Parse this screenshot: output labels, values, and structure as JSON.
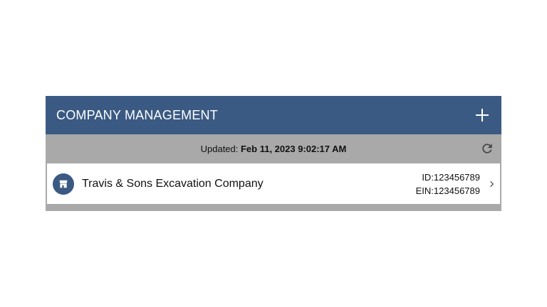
{
  "header": {
    "title": "COMPANY MANAGEMENT",
    "add_icon": "plus-icon"
  },
  "status": {
    "label": "Updated: ",
    "timestamp": "Feb 11, 2023 9:02:17 AM",
    "refresh_icon": "refresh-icon"
  },
  "companies": [
    {
      "name": "Travis & Sons Excavation Company",
      "id": "ID:123456789",
      "ein": "EIN:123456789",
      "icon": "storefront-icon"
    }
  ],
  "colors": {
    "header_bg": "#3a5a83",
    "status_bg": "#a9a9a9",
    "row_bg": "#ffffff"
  }
}
